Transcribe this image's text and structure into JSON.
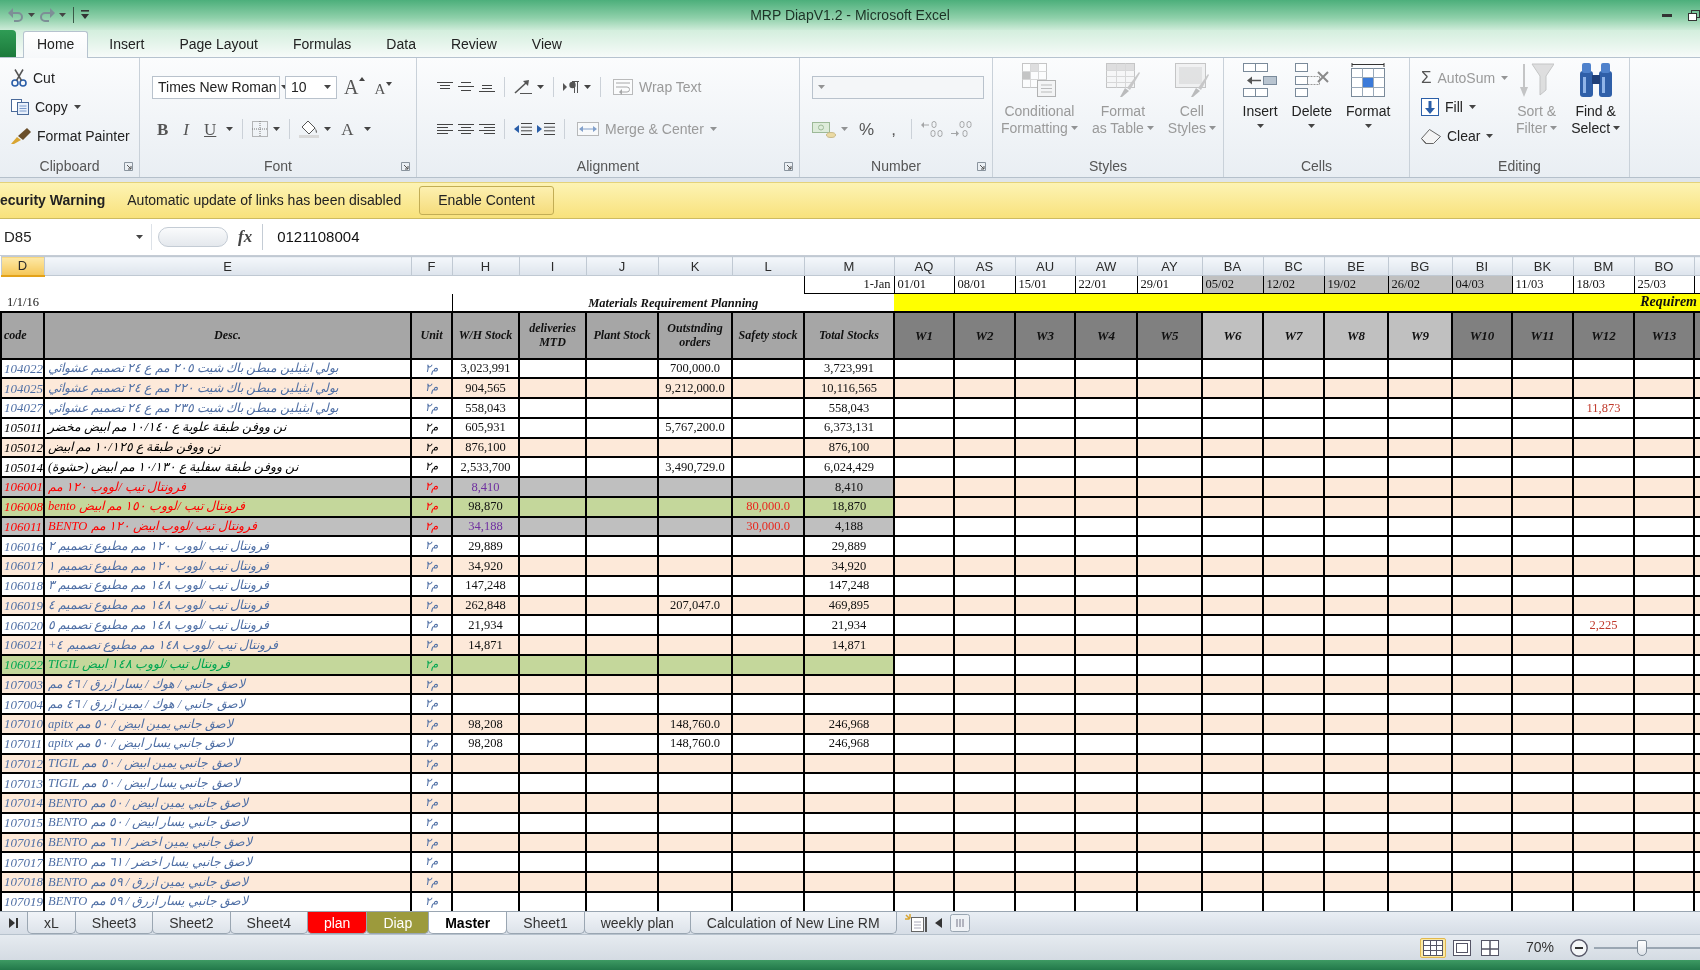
{
  "window": {
    "title": "MRP DiapV1.2 - Microsoft Excel"
  },
  "ribbon_tabs": [
    {
      "label": "Home",
      "selected": true
    },
    {
      "label": "Insert",
      "selected": false
    },
    {
      "label": "Page Layout",
      "selected": false
    },
    {
      "label": "Formulas",
      "selected": false
    },
    {
      "label": "Data",
      "selected": false
    },
    {
      "label": "Review",
      "selected": false
    },
    {
      "label": "View",
      "selected": false
    }
  ],
  "ribbon": {
    "clipboard": {
      "label": "Clipboard",
      "launcher": true,
      "commands": [
        {
          "label": "Cut",
          "kind": "cut",
          "dropdown": false
        },
        {
          "label": "Copy",
          "kind": "copy",
          "dropdown": true
        },
        {
          "label": "Format Painter",
          "kind": "painter",
          "dropdown": false
        }
      ]
    },
    "font": {
      "label": "Font",
      "launcher": true,
      "font_name": "Times New Roman",
      "font_size": "10",
      "size_buttons": [
        {
          "text": "A",
          "kind": "grow"
        },
        {
          "text": "A",
          "kind": "shrink"
        }
      ],
      "style_buttons": [
        {
          "text": "B",
          "kind": "bold"
        },
        {
          "text": "I",
          "kind": "italic"
        },
        {
          "text": "U",
          "kind": "underline"
        }
      ],
      "color_button": {
        "text": "A"
      }
    },
    "alignment": {
      "label": "Alignment",
      "launcher": true,
      "wrap_text": {
        "label": "Wrap Text",
        "disabled": true
      },
      "merge": {
        "label": "Merge & Center",
        "disabled": true
      }
    },
    "number": {
      "label": "Number",
      "launcher": true,
      "disabled": true,
      "percent": "%",
      "comma": ","
    },
    "styles": {
      "label": "Styles",
      "launcher": false,
      "commands": [
        {
          "lines": [
            "Conditional",
            "Formatting"
          ],
          "kind": "conditional",
          "disabled": true
        },
        {
          "lines": [
            "Format",
            "as Table"
          ],
          "kind": "table",
          "disabled": true
        },
        {
          "lines": [
            "Cell",
            "Styles"
          ],
          "kind": "cell-styles",
          "disabled": true
        }
      ]
    },
    "cells": {
      "label": "Cells",
      "launcher": false,
      "commands": [
        {
          "lines": [
            "Insert"
          ],
          "kind": "insert",
          "disabled": false
        },
        {
          "lines": [
            "Delete"
          ],
          "kind": "delete",
          "disabled": false
        },
        {
          "lines": [
            "Format"
          ],
          "kind": "format",
          "disabled": false
        }
      ]
    },
    "editing": {
      "label": "Editing",
      "launcher": false,
      "commands": [
        {
          "label": "AutoSum",
          "symbol": "Σ",
          "kind": "autosum",
          "disabled": true
        },
        {
          "label": "Fill",
          "kind": "fill",
          "disabled": false
        },
        {
          "label": "Clear",
          "kind": "clear",
          "disabled": false
        }
      ],
      "large": [
        {
          "lines": [
            "Sort &",
            "Filter"
          ],
          "kind": "sort",
          "disabled": true
        },
        {
          "lines": [
            "Find &",
            "Select"
          ],
          "kind": "find",
          "disabled": false
        }
      ]
    }
  },
  "security_bar": {
    "title": "ecurity Warning",
    "message": "Automatic update of links has been disabled",
    "button": "Enable Content"
  },
  "formula_bar": {
    "name_box": "D85",
    "function_label": "fx",
    "value": "0121108004"
  },
  "grid": {
    "fixed_columns": [
      {
        "letter": "D",
        "selected": true,
        "heading": "code"
      },
      {
        "letter": "E",
        "selected": false,
        "heading": "Desc."
      },
      {
        "letter": "F",
        "selected": false,
        "heading": "Unit"
      },
      {
        "letter": "H",
        "selected": false,
        "heading": "W/H Stock"
      },
      {
        "letter": "I",
        "selected": false,
        "heading": "deliveries MTD"
      },
      {
        "letter": "J",
        "selected": false,
        "heading": "Plant Stock"
      },
      {
        "letter": "K",
        "selected": false,
        "heading": "Outstnding orders"
      },
      {
        "letter": "L",
        "selected": false,
        "heading": "Safety stock"
      },
      {
        "letter": "M",
        "selected": false,
        "heading": "Total Stocks"
      }
    ],
    "week_columns": [
      {
        "letter": "AQ",
        "selected": false,
        "date": "01/01",
        "date_shaded": false,
        "label": "W1",
        "header_light": false
      },
      {
        "letter": "AS",
        "selected": false,
        "date": "08/01",
        "date_shaded": false,
        "label": "W2",
        "header_light": false
      },
      {
        "letter": "AU",
        "selected": false,
        "date": "15/01",
        "date_shaded": false,
        "label": "W3",
        "header_light": false
      },
      {
        "letter": "AW",
        "selected": false,
        "date": "22/01",
        "date_shaded": false,
        "label": "W4",
        "header_light": false
      },
      {
        "letter": "AY",
        "selected": false,
        "date": "29/01",
        "date_shaded": false,
        "label": "W5",
        "header_light": false
      },
      {
        "letter": "BA",
        "selected": false,
        "date": "05/02",
        "date_shaded": true,
        "label": "W6",
        "header_light": true
      },
      {
        "letter": "BC",
        "selected": false,
        "date": "12/02",
        "date_shaded": true,
        "label": "W7",
        "header_light": true
      },
      {
        "letter": "BE",
        "selected": false,
        "date": "19/02",
        "date_shaded": true,
        "label": "W8",
        "header_light": true
      },
      {
        "letter": "BG",
        "selected": false,
        "date": "26/02",
        "date_shaded": true,
        "label": "W9",
        "header_light": true
      },
      {
        "letter": "BI",
        "selected": false,
        "date": "04/03",
        "date_shaded": true,
        "label": "W10",
        "header_light": false
      },
      {
        "letter": "BK",
        "selected": false,
        "date": "11/03",
        "date_shaded": false,
        "label": "W11",
        "header_light": false
      },
      {
        "letter": "BM",
        "selected": false,
        "date": "18/03",
        "date_shaded": false,
        "label": "W12",
        "header_light": false
      },
      {
        "letter": "BO",
        "selected": false,
        "date": "25/03",
        "date_shaded": false,
        "label": "W13",
        "header_light": false
      }
    ],
    "start_date": "1-Jan",
    "report_date": "1/1/16",
    "title": "Materials Requirement Planning",
    "band_title": "Requirem",
    "rows": [
      {
        "kind": "normal",
        "code": "104022",
        "desc": "بولي ايثيلين مبطن باك شيت ٢٠٥ مم ع ٢٤ تصميم عشوائي",
        "unit": "م٢",
        "wh_stock": "3,023,991",
        "outstanding": "700,000.0",
        "total": "3,723,991",
        "banded": false
      },
      {
        "kind": "normal",
        "code": "104025",
        "desc": "بولي ايثيلين مبطن باك شيت ٢٢٠ مم ع ٢٤ تصميم عشوائي",
        "unit": "م٢",
        "wh_stock": "904,565",
        "outstanding": "9,212,000.0",
        "total": "10,116,565",
        "banded": true
      },
      {
        "kind": "normal",
        "code": "104027",
        "desc": "بولي ايثيلين مبطن باك شيت ٢٣٥ مم ع ٢٤ تصميم عشوائي",
        "unit": "م٢",
        "wh_stock": "558,043",
        "total": "558,043",
        "w12": "11,873",
        "banded": false
      },
      {
        "kind": "black",
        "code": "105011",
        "desc": "نن ووفن طبقة علوية ع ١٠/١٤٠ مم ابيض مخضر",
        "unit": "م٢",
        "wh_stock": "605,931",
        "outstanding": "5,767,200.0",
        "total": "6,373,131",
        "banded": false
      },
      {
        "kind": "black",
        "code": "105012",
        "desc": "نن ووفن طبقة ع ١٠/١٢٥ مم ابيض",
        "unit": "م٢",
        "wh_stock": "876,100",
        "total": "876,100",
        "banded": true
      },
      {
        "kind": "black",
        "code": "105014",
        "desc": "نن ووفن طبقة سفلية ع ١٠/١٣٠ مم ابيض (حشوة)",
        "unit": "م٢",
        "wh_stock": "2,533,700",
        "outstanding": "3,490,729.0",
        "total": "6,024,429",
        "banded": false
      },
      {
        "kind": "grey",
        "code": "106001",
        "desc": "فرونتال تيب /لووب ١٢٠ مم",
        "unit": "م٢",
        "wh_stock": "8,410",
        "total": "8,410",
        "banded": true
      },
      {
        "kind": "alert",
        "code": "106008",
        "desc": "فرونتال تيب /لووب ١٥٠ مم ابيض bento",
        "unit": "م٢",
        "wh_stock": "98,870",
        "safety": "80,000.0",
        "total": "18,870",
        "banded": true
      },
      {
        "kind": "grey",
        "code": "106011",
        "desc": "فرونتال تيب /لووب ابيض ١٢٠ مم BENTO",
        "unit": "م٢",
        "wh_stock": "34,188",
        "safety": "30,000.0",
        "total": "4,188",
        "banded": false
      },
      {
        "kind": "normal",
        "code": "106016",
        "desc": "فرونتال تيب /لووب ١٢٠ مم مطبوع تصميم ٢",
        "unit": "م٢",
        "wh_stock": "29,889",
        "total": "29,889",
        "banded": false
      },
      {
        "kind": "normal",
        "code": "106017",
        "desc": "فرونتال تيب /لووب ١٢٠ مم مطبوع تصميم ١",
        "unit": "م٢",
        "wh_stock": "34,920",
        "total": "34,920",
        "banded": true
      },
      {
        "kind": "normal",
        "code": "106018",
        "desc": "فرونتال تيب /لووب ١٤٨ مم مطبوع تصميم ٣",
        "unit": "م٢",
        "wh_stock": "147,248",
        "total": "147,248",
        "banded": false
      },
      {
        "kind": "normal",
        "code": "106019",
        "desc": "فرونتال تيب /لووب ١٤٨ مم مطبوع تصميم ٤",
        "unit": "م٢",
        "wh_stock": "262,848",
        "outstanding": "207,047.0",
        "total": "469,895",
        "banded": true
      },
      {
        "kind": "normal",
        "code": "106020",
        "desc": "فرونتال تيب /لووب ١٤٨ مم مطبوع تصميم ٥",
        "unit": "م٢",
        "wh_stock": "21,934",
        "total": "21,934",
        "w12": "2,225",
        "banded": false
      },
      {
        "kind": "normal",
        "code": "106021",
        "desc": "فرونتال تيب /لووب ١٤٨ مم مطبوع تصميم ٤+",
        "unit": "م٢",
        "wh_stock": "14,871",
        "total": "14,871",
        "banded": true
      },
      {
        "kind": "green",
        "code": "106022",
        "desc": "فرونتال تيب /لووب ١٤٨ ابيض TIGIL",
        "unit": "م٢",
        "banded": false
      },
      {
        "kind": "normal",
        "code": "107003",
        "desc": "لاصق جانبي / هوك / يسار ازرق / ٤٦ مم",
        "unit": "م٢",
        "banded": true
      },
      {
        "kind": "normal",
        "code": "107004",
        "desc": "لاصق جانبي / هوك / يمين ازرق / ٤٦ مم",
        "unit": "م٢",
        "banded": false
      },
      {
        "kind": "normal",
        "code": "107010",
        "desc": "لاصق جانبي يمين ابيض / ٥٠ مم apitx",
        "unit": "م٢",
        "wh_stock": "98,208",
        "outstanding": "148,760.0",
        "total": "246,968",
        "banded": true
      },
      {
        "kind": "normal",
        "code": "107011",
        "desc": "لاصق جانبي يسار ابيض / ٥٠ مم apitx",
        "unit": "م٢",
        "wh_stock": "98,208",
        "outstanding": "148,760.0",
        "total": "246,968",
        "banded": false
      },
      {
        "kind": "normal",
        "code": "107012",
        "desc": "لاصق جانبي يمين ابيض / ٥٠ مم TIGIL",
        "unit": "م٢",
        "banded": true
      },
      {
        "kind": "normal",
        "code": "107013",
        "desc": "لاصق جانبي يسار ابيض / ٥٠ مم TIGIL",
        "unit": "م٢",
        "banded": false
      },
      {
        "kind": "normal",
        "code": "107014",
        "desc": "لاصق جانبي يمين ابيض / ٥٠ مم BENTO",
        "unit": "م٢",
        "banded": true
      },
      {
        "kind": "normal",
        "code": "107015",
        "desc": "لاصق جانبي يسار ابيض / ٥٠ مم BENTO",
        "unit": "م٢",
        "banded": false
      },
      {
        "kind": "normal",
        "code": "107016",
        "desc": "لاصق جانبي يمين اخضر / ٦١ مم BENTO",
        "unit": "م٢",
        "banded": true
      },
      {
        "kind": "normal",
        "code": "107017",
        "desc": "لاصق جانبي يسار اخضر / ٦١ مم BENTO",
        "unit": "م٢",
        "banded": false
      },
      {
        "kind": "normal",
        "code": "107018",
        "desc": "لاصق جانبي يمين ازرق / ٥٩ مم BENTO",
        "unit": "م٢",
        "banded": true
      },
      {
        "kind": "normal",
        "code": "107019",
        "desc": "لاصق جانبي يسار ازرق / ٥٩ مم BENTO",
        "unit": "م٢",
        "banded": false
      }
    ]
  },
  "sheet_tabs": [
    {
      "label": "xL",
      "selected": false
    },
    {
      "label": "Sheet3",
      "selected": false
    },
    {
      "label": "Sheet2",
      "selected": false
    },
    {
      "label": "Sheet4",
      "selected": false
    },
    {
      "label": "plan",
      "selected": false,
      "color": "#ff0000"
    },
    {
      "label": "Diap",
      "selected": false,
      "color": "#9c9a3c"
    },
    {
      "label": "Master",
      "selected": true
    },
    {
      "label": "Sheet1",
      "selected": false
    },
    {
      "label": "weekly plan",
      "selected": false
    },
    {
      "label": "Calculation of New Line RM",
      "selected": false
    }
  ],
  "status_bar": {
    "views": [
      {
        "kind": "normal",
        "selected": true
      },
      {
        "kind": "page-layout",
        "selected": false
      },
      {
        "kind": "page-break",
        "selected": false
      }
    ],
    "zoom": "70%",
    "zoom_slider": {
      "level": 0.45
    }
  }
}
